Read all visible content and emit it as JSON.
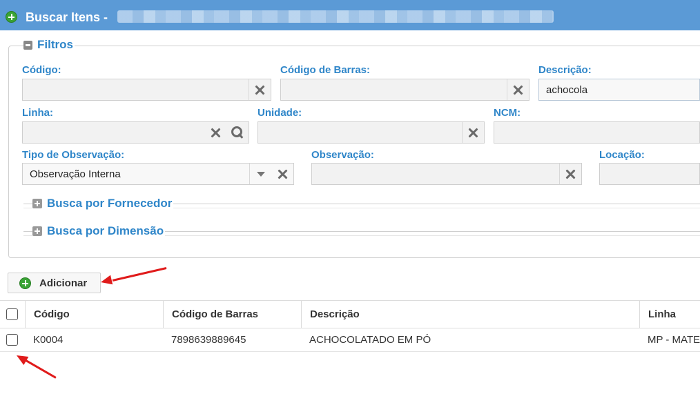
{
  "window": {
    "title": "Buscar Itens -",
    "title_icon": "add-circle-icon"
  },
  "filters": {
    "legend": "Filtros",
    "codigo": {
      "label": "Código:",
      "value": ""
    },
    "codigo_barras": {
      "label": "Código de Barras:",
      "value": ""
    },
    "descricao": {
      "label": "Descrição:",
      "value": "achocola"
    },
    "linha": {
      "label": "Linha:",
      "value": ""
    },
    "unidade": {
      "label": "Unidade:",
      "value": ""
    },
    "ncm": {
      "label": "NCM:",
      "value": ""
    },
    "tipo_observacao": {
      "label": "Tipo de Observação:",
      "value": "Observação Interna"
    },
    "observacao": {
      "label": "Observação:",
      "value": ""
    },
    "locacao": {
      "label": "Locação:",
      "value": ""
    },
    "busca_fornecedor": "Busca por Fornecedor",
    "busca_dimensao": "Busca por Dimensão"
  },
  "toolbar": {
    "add_label": "Adicionar"
  },
  "table": {
    "columns": [
      "Código",
      "Código de Barras",
      "Descrição",
      "Linha"
    ],
    "rows": [
      {
        "codigo": "K0004",
        "codigo_barras": "7898639889645",
        "descricao": "ACHOCOLATADO EM PÓ",
        "linha": "MP - MATE"
      }
    ]
  },
  "colors": {
    "titlebar": "#5b9ad6",
    "label_blue": "#2f86c9",
    "annotation_red": "#e01b1b"
  }
}
